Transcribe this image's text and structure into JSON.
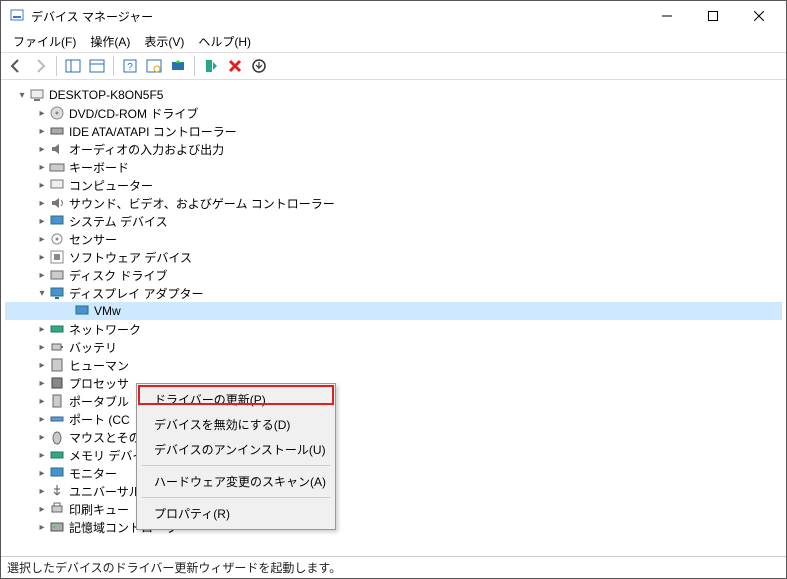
{
  "window": {
    "title": "デバイス マネージャー"
  },
  "menu": {
    "file": "ファイル(F)",
    "action": "操作(A)",
    "view": "表示(V)",
    "help": "ヘルプ(H)"
  },
  "tree": {
    "root": "DESKTOP-K8ON5F5",
    "n0": "DVD/CD-ROM ドライブ",
    "n1": "IDE ATA/ATAPI コントローラー",
    "n2": "オーディオの入力および出力",
    "n3": "キーボード",
    "n4": "コンピューター",
    "n5": "サウンド、ビデオ、およびゲーム コントローラー",
    "n6": "システム デバイス",
    "n7": "センサー",
    "n8": "ソフトウェア デバイス",
    "n9": "ディスク ドライブ",
    "n10": "ディスプレイ アダプター",
    "n10c": "VMw",
    "n11": "ネットワーク",
    "n12": "バッテリ",
    "n13": "ヒューマン",
    "n14": "プロセッサ",
    "n15": "ポータブル",
    "n16": "ポート (CC",
    "n17": "マウスとそのほかのポインティング デバイス",
    "n18": "メモリ デバイス",
    "n19": "モニター",
    "n20": "ユニバーサル シリアル バス コントローラー",
    "n21": "印刷キュー",
    "n22": "記憶域コントローラー"
  },
  "context": {
    "c0": "ドライバーの更新(P)",
    "c1": "デバイスを無効にする(D)",
    "c2": "デバイスのアンインストール(U)",
    "c3": "ハードウェア変更のスキャン(A)",
    "c4": "プロパティ(R)"
  },
  "status": {
    "text": "選択したデバイスのドライバー更新ウィザードを起動します。"
  }
}
